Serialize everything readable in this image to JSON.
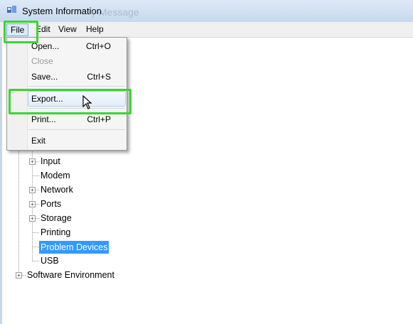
{
  "window": {
    "title": "System Information",
    "ghost_title": "y Message"
  },
  "menubar": {
    "items": [
      {
        "label": "File"
      },
      {
        "label": "Edit"
      },
      {
        "label": "View"
      },
      {
        "label": "Help"
      }
    ]
  },
  "file_menu": {
    "items": [
      {
        "label": "Open...",
        "shortcut": "Ctrl+O",
        "enabled": true
      },
      {
        "label": "Close",
        "shortcut": "",
        "enabled": false
      },
      {
        "label": "Save...",
        "shortcut": "Ctrl+S",
        "enabled": true
      },
      {
        "label": "Export...",
        "shortcut": "",
        "enabled": true,
        "hovered": true
      },
      {
        "label": "Print...",
        "shortcut": "Ctrl+P",
        "enabled": true
      },
      {
        "label": "Exit",
        "shortcut": "",
        "enabled": true
      }
    ]
  },
  "tree": {
    "children": [
      {
        "label": "Input",
        "expandable": true
      },
      {
        "label": "Modem",
        "expandable": false
      },
      {
        "label": "Network",
        "expandable": true
      },
      {
        "label": "Ports",
        "expandable": true
      },
      {
        "label": "Storage",
        "expandable": true
      },
      {
        "label": "Printing",
        "expandable": false
      },
      {
        "label": "Problem Devices",
        "expandable": false,
        "selected": true
      },
      {
        "label": "USB",
        "expandable": false
      }
    ],
    "top_level": [
      {
        "label": "Software Environment",
        "expandable": true
      }
    ]
  },
  "colors": {
    "highlight_box": "#3bd433",
    "selection": "#3399ff"
  }
}
